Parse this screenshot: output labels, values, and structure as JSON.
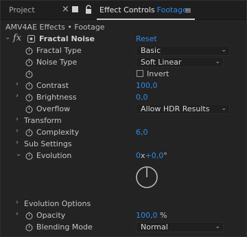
{
  "tabs": {
    "project_label": "Project",
    "close_glyph": "×",
    "menu_glyph": "≡",
    "active_label": "Effect Controls",
    "active_accent": "Footage"
  },
  "breadcrumb": "AMV4AE Effects • Footage",
  "effect": {
    "fx_glyph": "fx",
    "name": "Fractal Noise",
    "reset_label": "Reset"
  },
  "properties": {
    "fractal_type": {
      "label": "Fractal Type",
      "value": "Basic"
    },
    "noise_type": {
      "label": "Noise Type",
      "value": "Soft Linear"
    },
    "invert": {
      "label": "Invert",
      "checked": false
    },
    "contrast": {
      "label": "Contrast",
      "value": "100,0"
    },
    "brightness": {
      "label": "Brightness",
      "value": "0,0"
    },
    "overflow": {
      "label": "Overflow",
      "value": "Allow HDR Results"
    },
    "transform": {
      "label": "Transform"
    },
    "complexity": {
      "label": "Complexity",
      "value": "6,0"
    },
    "sub_settings": {
      "label": "Sub Settings"
    },
    "evolution": {
      "label": "Evolution",
      "revolutions": "0",
      "x_glyph": "x",
      "degrees": "+0,0",
      "unit": "°"
    },
    "evolution_options": {
      "label": "Evolution Options"
    },
    "opacity": {
      "label": "Opacity",
      "value": "100,0",
      "unit": "%"
    },
    "blending_mode": {
      "label": "Blending Mode",
      "value": "Normal"
    }
  },
  "glyphs": {
    "expand": "›",
    "collapse": "⌄",
    "chevron": "⌄"
  },
  "colors": {
    "accent": "#2d8ceb",
    "background": "#232323",
    "text": "#c2c2c2"
  },
  "icons": [
    "close-icon",
    "square-icon",
    "lock-icon",
    "menu-icon",
    "fx-icon",
    "stopwatch-icon",
    "chevron-down-icon",
    "dial-icon"
  ]
}
